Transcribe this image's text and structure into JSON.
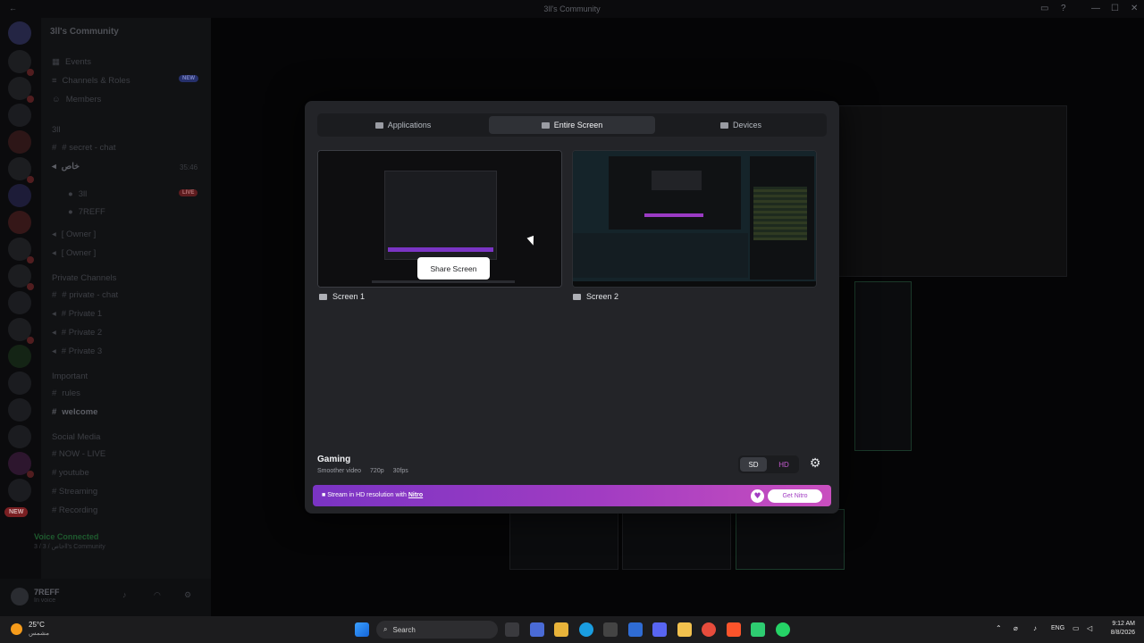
{
  "window": {
    "title": "3ll's Community"
  },
  "server": {
    "name": "3ll's Community"
  },
  "channels": {
    "items": [
      {
        "label": "Events"
      },
      {
        "label": "Channels & Roles",
        "badge": "NEW"
      },
      {
        "label": "Members"
      },
      {
        "label": "3ll"
      },
      {
        "label": "# secret - chat"
      },
      {
        "label": "خاص"
      },
      {
        "label": "3ll"
      },
      {
        "label": "7REFF"
      },
      {
        "label": "[ Owner ]"
      },
      {
        "label": "[ Owner ]"
      },
      {
        "label": "Private Channels"
      },
      {
        "label": "# private - chat"
      },
      {
        "label": "# Private 1"
      },
      {
        "label": "# Private 2"
      },
      {
        "label": "# Private 3"
      },
      {
        "label": "Important"
      },
      {
        "label": "rules"
      },
      {
        "label": "welcome"
      },
      {
        "label": "Social Media"
      },
      {
        "label": "# NOW - LIVE"
      },
      {
        "label": "# youtube"
      },
      {
        "label": "# Streaming"
      },
      {
        "label": "# Recording"
      }
    ],
    "live_badge": "LIVE",
    "timestamp": "35:46"
  },
  "rail": {
    "new_badge": "NEW"
  },
  "voice": {
    "status": "Voice Connected",
    "channel": "3 / خاص / 3ll's Community"
  },
  "user": {
    "name": "7REFF",
    "status": "In voice"
  },
  "modal": {
    "tabs": [
      {
        "label": "Applications",
        "icon": "window-icon"
      },
      {
        "label": "Entire Screen",
        "icon": "monitor-icon"
      },
      {
        "label": "Devices",
        "icon": "camera-icon"
      }
    ],
    "screens": [
      {
        "label": "Screen 1"
      },
      {
        "label": "Screen 2"
      }
    ],
    "share_button": "Share Screen",
    "quality": {
      "title": "Gaming",
      "subtitle": "Smoother video",
      "resolution": "720p",
      "fps": "30fps"
    },
    "sd_label": "SD",
    "hd_label": "HD",
    "nitro": {
      "text": "Stream in HD resolution with",
      "link": "Nitro",
      "button": "Get Nitro"
    }
  },
  "taskbar": {
    "weather_temp": "25°C",
    "weather_desc": "مشمس",
    "search_placeholder": "Search",
    "lang": "ENG",
    "time": "9:12 AM",
    "date": "8/8/2026"
  },
  "colors": {
    "accent": "#a13cc2",
    "nitro_start": "#7a34c4",
    "nitro_end": "#c94fbf",
    "hd": "#c55ad1"
  }
}
